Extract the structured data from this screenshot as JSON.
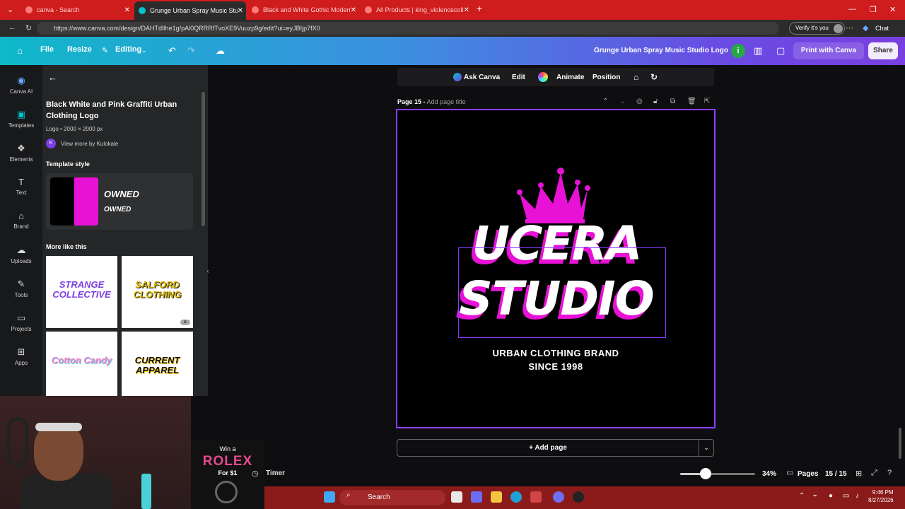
{
  "browser": {
    "tabs": [
      {
        "title": "canva - Search"
      },
      {
        "title": "Grunge Urban Spray Music Studio"
      },
      {
        "title": "Black and White Gothic Modern C"
      },
      {
        "title": "All Products | king_violencecollabs"
      }
    ],
    "url": "https://www.canva.com/design/DAHTdlIhe1g/pAl0QRRRfTvoXE9Vuuzp9g/edit?ui=eyJBIjp7fX0",
    "verify_label": "Verify it's you",
    "chat_label": "Chat"
  },
  "header": {
    "file": "File",
    "resize": "Resize",
    "editing": "Editing",
    "doc_title": "Grunge Urban Spray Music Studio Logo",
    "profile_initial": "i",
    "print": "Print with Canva",
    "share": "Share"
  },
  "rail": [
    {
      "label": "Canva AI",
      "icon": "canva-ai-icon"
    },
    {
      "label": "Templates",
      "icon": "templates-icon"
    },
    {
      "label": "Elements",
      "icon": "elements-icon"
    },
    {
      "label": "Text",
      "icon": "text-icon"
    },
    {
      "label": "Brand",
      "icon": "brand-icon"
    },
    {
      "label": "Uploads",
      "icon": "uploads-icon"
    },
    {
      "label": "Tools",
      "icon": "tools-icon"
    },
    {
      "label": "Projects",
      "icon": "projects-icon"
    },
    {
      "label": "Apps",
      "icon": "apps-icon"
    }
  ],
  "panel": {
    "title": "Black White and Pink Graffiti Urban Clothing Logo",
    "meta": "Logo • 2000 × 2000 px",
    "creator_initial": "K",
    "creator": "View more by Kulokale",
    "style_heading": "Template style",
    "style_font_1": "OWNED",
    "style_font_2": "OWNED",
    "more_heading": "More like this",
    "thumbs": [
      {
        "text": "STRANGE COLLECTIVE"
      },
      {
        "text": "SALFORD CLOTHING"
      },
      {
        "text": "Cotton Candy"
      },
      {
        "text": "CURRENT APPAREL"
      }
    ]
  },
  "promo": {
    "win": "Win a",
    "prize": "ROLEX",
    "price": "For $1"
  },
  "floatbar": {
    "ask": "Ask Canva",
    "edit": "Edit",
    "animate": "Animate",
    "position": "Position"
  },
  "page": {
    "label": "Page 15 -",
    "add_title": "Add page title"
  },
  "design": {
    "line1": "UCERA",
    "line2": "STUDIO",
    "tagline1": "URBAN CLOTHING BRAND",
    "tagline2": "SINCE 1998"
  },
  "add_page": "+ Add page",
  "status": {
    "timer": "Timer",
    "zoom": "34%",
    "zoom_fraction": 0.34,
    "pages_label": "Pages",
    "pages_count": "15 / 15"
  },
  "taskbar": {
    "search": "Search",
    "time": "9:46 PM",
    "date": "8/27/2026"
  },
  "colors": {
    "accent": "#8b3dff",
    "pink": "#e811d6",
    "teal": "#00c4cc"
  }
}
